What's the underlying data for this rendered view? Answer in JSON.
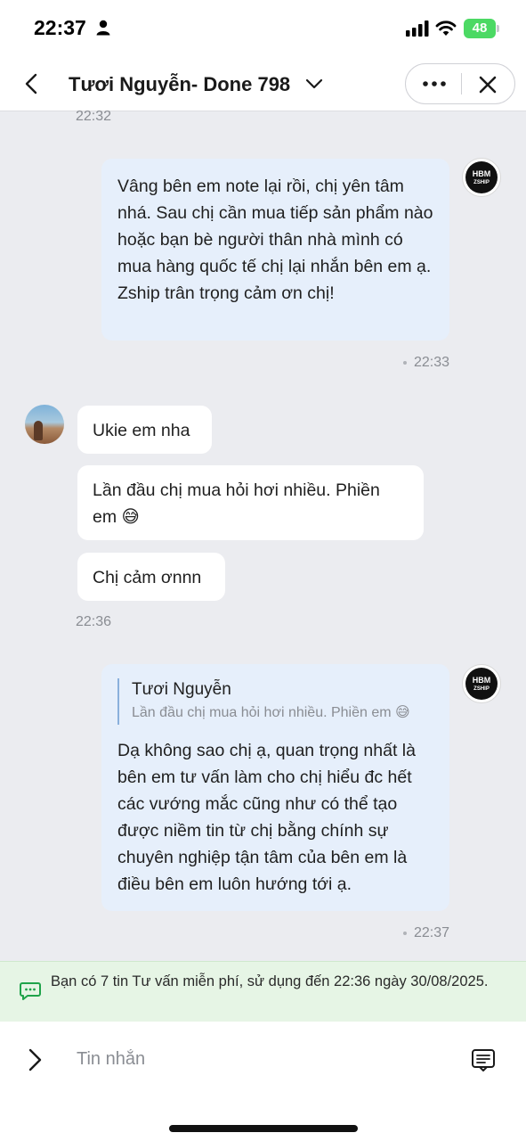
{
  "status_bar": {
    "time": "22:37",
    "battery": "48"
  },
  "header": {
    "title": "Tươi Nguyễn- Done 798"
  },
  "messages": [
    {
      "time": "22:32"
    },
    {
      "text": "Vâng bên em note lại rồi, chị yên tâm nhá. Sau chị cần mua tiếp sản phẩm nào hoặc bạn bè người thân nhà mình có mua hàng quốc tế chị lại nhắn bên em ạ. Zship trân trọng cảm ơn chị!",
      "time": "22:33"
    },
    {
      "text": "Ukie em nha"
    },
    {
      "text": "Lần đầu chị mua hỏi hơi nhiều. Phiền em 😅"
    },
    {
      "text": "Chị cảm ơnnn",
      "time": "22:36"
    },
    {
      "reply_name": "Tươi Nguyễn",
      "reply_text": "Lần đầu chị mua hỏi hơi nhiều. Phiền em 😅",
      "text": "Dạ không sao chị ạ, quan trọng nhất là bên em tư vấn làm cho chị hiểu đc hết các vướng mắc cũng như có thể tạo được niềm tin từ chị bằng chính sự chuyên nghiệp tận tâm của bên em là điều bên em luôn hướng tới ạ.",
      "time": "22:37"
    }
  ],
  "shop_avatar": {
    "line1": "HBM",
    "line2": "ZSHIP"
  },
  "notice": {
    "text": "Bạn có 7 tin Tư vấn miễn phí, sử dụng đến 22:36 ngày 30/08/2025."
  },
  "composer": {
    "placeholder": "Tin nhắn"
  },
  "colors": {
    "outgoing_bubble": "#e6effb",
    "incoming_bubble": "#ffffff",
    "background": "#ebecf0",
    "notice_bg": "#e6f5e5",
    "notice_icon": "#1fa34a"
  },
  "icons": [
    "person-icon",
    "signal-icon",
    "wifi-icon",
    "back-icon",
    "chevron-down-icon",
    "more-icon",
    "close-icon",
    "chat-notice-icon",
    "chevron-right-icon",
    "sticker-icon"
  ]
}
